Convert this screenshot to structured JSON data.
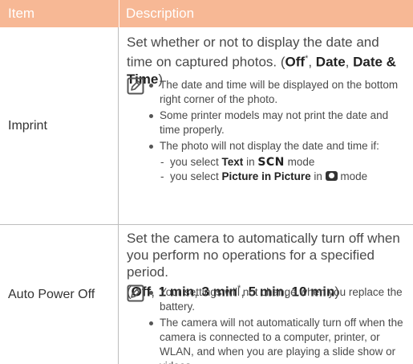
{
  "header": {
    "item_label": "Item",
    "description_label": "Description"
  },
  "rows": [
    {
      "item": "Imprint",
      "lead_text": "Set whether or not to display the date and time on captured photos. (",
      "options": [
        "Off",
        "Date",
        "Date & Time"
      ],
      "default_marker": "*",
      "note_icon": "note-pencil-icon",
      "bullets": [
        "The date and time will be displayed on the bottom right corner of the photo.",
        "Some printer models may not print the date and time properly.",
        "The photo will not display the date and time if:"
      ],
      "subitems": [
        {
          "prefix": "you select ",
          "bold": "Text",
          "middle": " in ",
          "mode_label": "SCN",
          "suffix": " mode"
        },
        {
          "prefix": "you select ",
          "bold": "Picture in Picture",
          "middle": " in ",
          "mode_icon": "camera-mode-icon",
          "suffix": " mode"
        }
      ]
    },
    {
      "item": "Auto Power Off",
      "lead_text": "Set the camera to automatically turn off when you perform no operations for a specified period.",
      "options": [
        "Off",
        "1 min",
        "3 min",
        "5 min",
        "10 min"
      ],
      "default_marker": "*",
      "note_icon": "note-pencil-icon",
      "bullets": [
        "Your settings will not change when you replace the battery.",
        "The camera will not automatically turn off when the camera is connected to a computer, printer, or WLAN, and when you are playing a slide show or videos."
      ]
    }
  ],
  "colors": {
    "header_bg": "#f7b895",
    "header_text": "#ffffff",
    "divider": "#bdbdbd"
  }
}
